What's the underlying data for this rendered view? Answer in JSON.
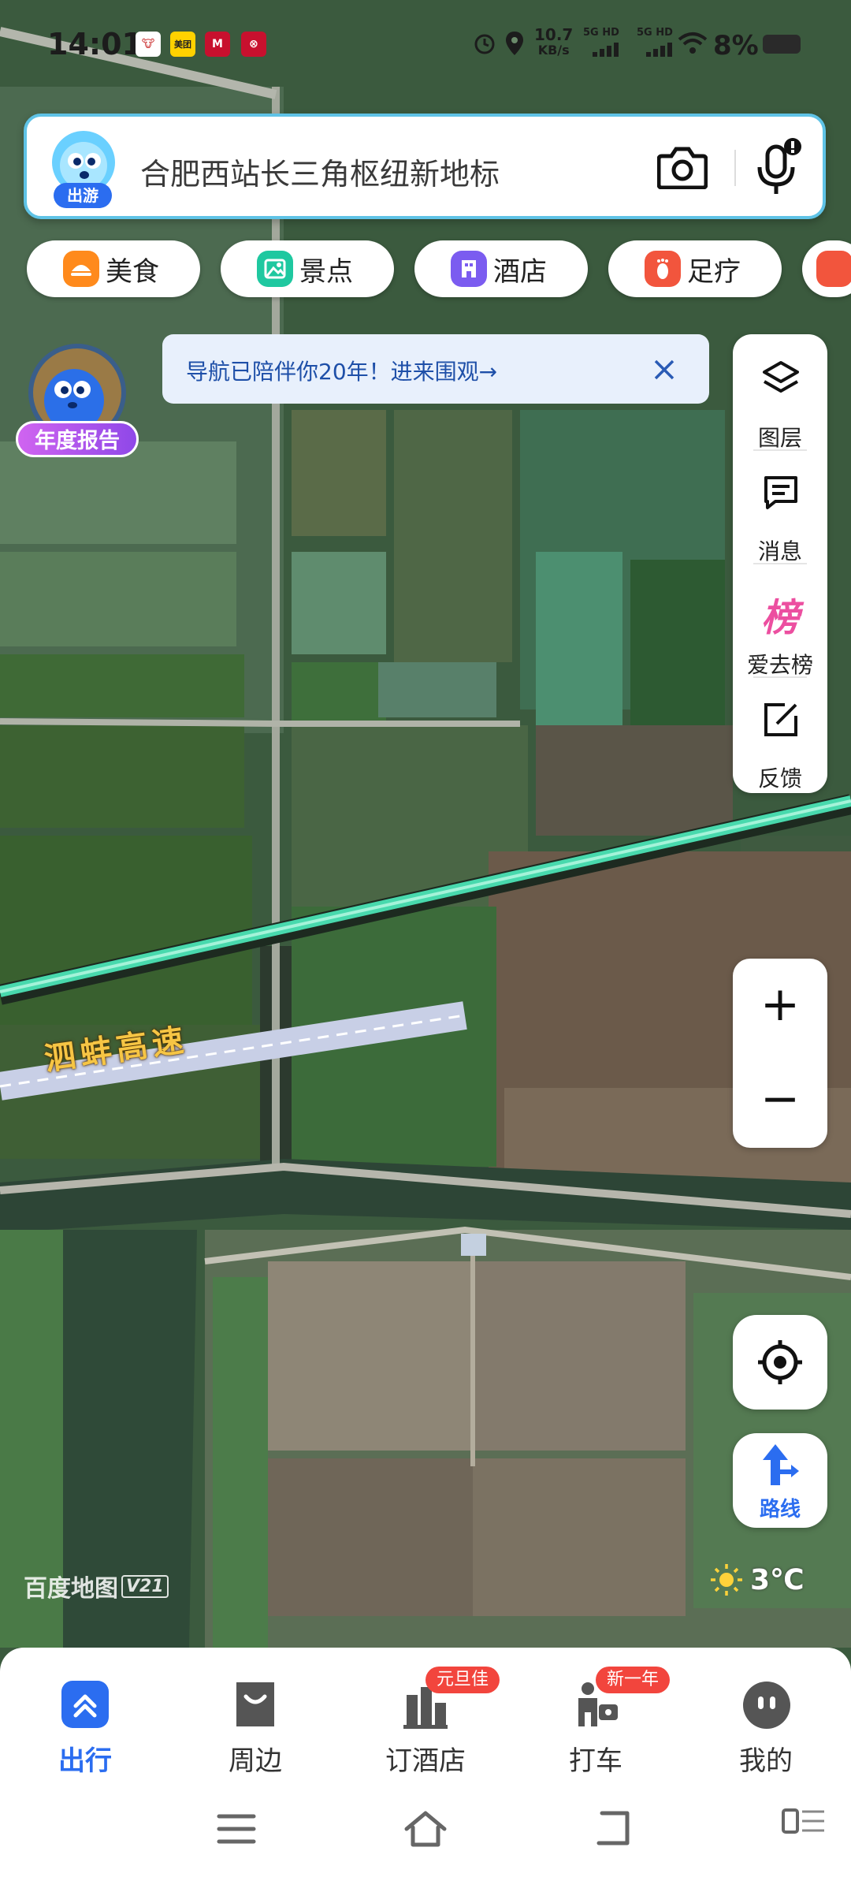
{
  "status_bar": {
    "time": "14:01",
    "app_icons": [
      "美团",
      "M",
      "⊗"
    ],
    "net_speed_value": "10.7",
    "net_speed_unit": "KB/s",
    "signal_labels": [
      "5G HD",
      "5G HD"
    ],
    "battery": "8%"
  },
  "search": {
    "query": "合肥西站长三角枢纽新地标",
    "mascot_tag": "出游",
    "camera_icon": "camera-icon",
    "mic_icon": "microphone-icon"
  },
  "chips": [
    {
      "label": "美食",
      "icon": "food-icon",
      "color": "#ff8a1c"
    },
    {
      "label": "景点",
      "icon": "scenery-icon",
      "color": "#1fc8a0"
    },
    {
      "label": "酒店",
      "icon": "hotel-icon",
      "color": "#7b5cf0"
    },
    {
      "label": "足疗",
      "icon": "foot-massage-icon",
      "color": "#f2553d"
    }
  ],
  "banner": {
    "text": "导航已陪伴你20年！进来围观→"
  },
  "annual_report": {
    "label": "年度报告"
  },
  "right_panel": [
    {
      "label": "图层",
      "icon": "layers-icon"
    },
    {
      "label": "消息",
      "icon": "message-icon"
    },
    {
      "label": "爱去榜",
      "icon": "ranking-icon",
      "glyph": "榜"
    },
    {
      "label": "反馈",
      "icon": "feedback-icon"
    }
  ],
  "zoom": {
    "in": "+",
    "out": "−"
  },
  "map": {
    "road_label": "泗蚌高速",
    "brand": "百度地图",
    "version": "V21",
    "weather_temp": "3℃"
  },
  "route_button": {
    "label": "路线"
  },
  "bottom_nav": [
    {
      "label": "出行",
      "icon": "travel-icon",
      "active": true
    },
    {
      "label": "周边",
      "icon": "nearby-icon"
    },
    {
      "label": "订酒店",
      "icon": "hotel-booking-icon",
      "badge": "元旦佳"
    },
    {
      "label": "打车",
      "icon": "taxi-icon",
      "badge": "新一年"
    },
    {
      "label": "我的",
      "icon": "profile-icon"
    }
  ],
  "colors": {
    "accent": "#2b6df0",
    "route_green": "#4be0b0",
    "badge_red": "#f2453d"
  }
}
